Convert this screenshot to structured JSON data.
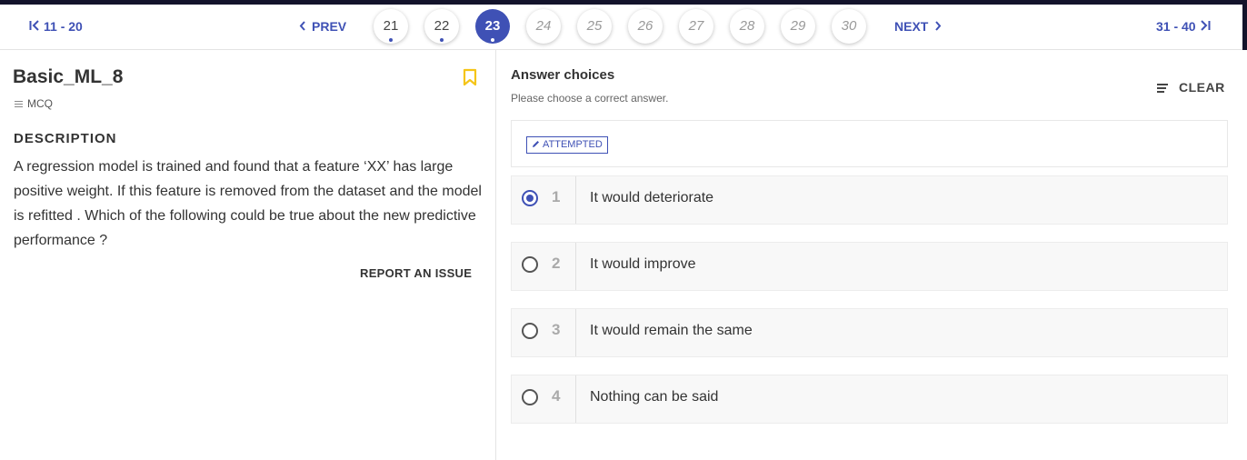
{
  "nav": {
    "first_range": "11 - 20",
    "prev_label": "PREV",
    "pages": [
      {
        "label": "21",
        "state": "done"
      },
      {
        "label": "22",
        "state": "done"
      },
      {
        "label": "23",
        "state": "active"
      },
      {
        "label": "24",
        "state": "pending"
      },
      {
        "label": "25",
        "state": "pending"
      },
      {
        "label": "26",
        "state": "pending"
      },
      {
        "label": "27",
        "state": "pending"
      },
      {
        "label": "28",
        "state": "pending"
      },
      {
        "label": "29",
        "state": "pending"
      },
      {
        "label": "30",
        "state": "pending"
      }
    ],
    "next_label": "NEXT",
    "last_range": "31 - 40"
  },
  "question": {
    "title": "Basic_ML_8",
    "type": "MCQ",
    "description_heading": "DESCRIPTION",
    "description": "A regression model is trained and found that a feature ‘XX’ has large positive weight. If this feature is removed from the dataset and the model is refitted . Which of the following could be true about the new predictive performance ?",
    "report_label": "REPORT AN ISSUE",
    "bookmark_icon": "bookmark-icon"
  },
  "answers": {
    "title": "Answer choices",
    "subtitle": "Please choose a correct answer.",
    "clear_label": "CLEAR",
    "status_badge": "ATTEMPTED",
    "selected": 1,
    "options": [
      {
        "num": "1",
        "text": "It would deteriorate"
      },
      {
        "num": "2",
        "text": "It would improve"
      },
      {
        "num": "3",
        "text": "It would remain the same"
      },
      {
        "num": "4",
        "text": "Nothing can be said"
      }
    ]
  },
  "colors": {
    "accent": "#3f51b5",
    "bookmark": "#f5c518",
    "top_bar": "#13132b"
  }
}
